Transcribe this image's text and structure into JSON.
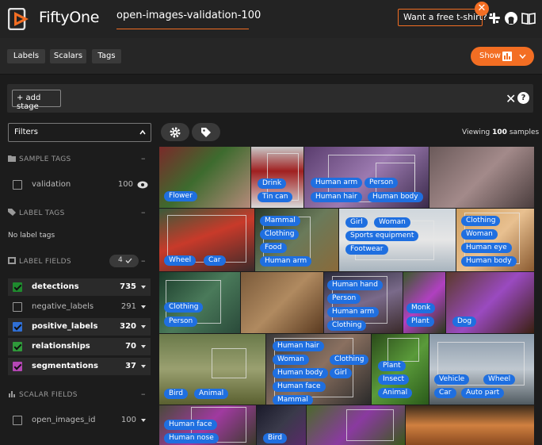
{
  "header": {
    "brand": "FiftyOne",
    "dataset_name": "open-images-validation-100",
    "tshirt_label": "Want a free t-shirt?",
    "close_badge": "✕"
  },
  "toolbar": {
    "tabs": [
      "Labels",
      "Scalars",
      "Tags"
    ],
    "show_label": "Show"
  },
  "stage": {
    "add_stage": "+ add stage",
    "close": "✕",
    "help": "?"
  },
  "sidebar": {
    "filters_label": "Filters",
    "sample_tags": {
      "title": "SAMPLE TAGS",
      "items": [
        {
          "label": "validation",
          "count": "100"
        }
      ]
    },
    "label_tags": {
      "title": "LABEL TAGS",
      "empty": "No label tags"
    },
    "label_fields": {
      "title": "LABEL FIELDS",
      "badge": "4",
      "items": [
        {
          "label": "detections",
          "count": "735",
          "color": "#1f8a2e",
          "checked": true
        },
        {
          "label": "negative_labels",
          "count": "291",
          "color": "",
          "checked": false
        },
        {
          "label": "positive_labels",
          "count": "320",
          "color": "#2f6fd6",
          "checked": true
        },
        {
          "label": "relationships",
          "count": "70",
          "color": "#2f9a3a",
          "checked": true
        },
        {
          "label": "segmentations",
          "count": "37",
          "color": "#b446b4",
          "checked": true
        }
      ]
    },
    "scalar_fields": {
      "title": "SCALAR FIELDS",
      "items": [
        {
          "label": "open_images_id",
          "count": "100"
        }
      ]
    }
  },
  "grid": {
    "viewing_prefix": "Viewing",
    "viewing_count": "100",
    "viewing_suffix": "samples",
    "chip_color": "#1f6fe0",
    "tiles": [
      {
        "chips": [
          "Flower"
        ]
      },
      {
        "chips": [
          "Drink",
          "Tin can"
        ]
      },
      {
        "chips": [
          "Human arm",
          "Person",
          "Human hair",
          "Human body"
        ]
      },
      {
        "chips": []
      },
      {
        "chips": [
          "Wheel",
          "Car"
        ]
      },
      {
        "chips": [
          "Mammal",
          "Clothing",
          "Food",
          "Human arm"
        ]
      },
      {
        "chips": [
          "Girl",
          "Woman",
          "Sports equipment",
          "Footwear"
        ]
      },
      {
        "chips": [
          "Clothing",
          "Woman",
          "Human eye",
          "Human body"
        ]
      },
      {
        "chips": [
          "Clothing",
          "Person"
        ]
      },
      {
        "chips": []
      },
      {
        "chips": [
          "Human hand",
          "Person",
          "Human arm",
          "Clothing"
        ]
      },
      {
        "chips": [
          "Monk",
          "Plant"
        ]
      },
      {
        "chips": [
          "Dog"
        ]
      },
      {
        "chips": [
          "Bird",
          "Animal"
        ]
      },
      {
        "chips": [
          "Human hair",
          "Woman",
          "Clothing",
          "Human body",
          "Girl",
          "Human face",
          "Mammal"
        ]
      },
      {
        "chips": [
          "Plant",
          "Insect",
          "Animal"
        ]
      },
      {
        "chips": [
          "Vehicle",
          "Wheel",
          "Car",
          "Auto part"
        ]
      },
      {
        "chips": [
          "Human face",
          "Human nose"
        ]
      },
      {
        "chips": [
          "Bird"
        ]
      },
      {
        "chips": []
      },
      {
        "chips": []
      }
    ]
  }
}
